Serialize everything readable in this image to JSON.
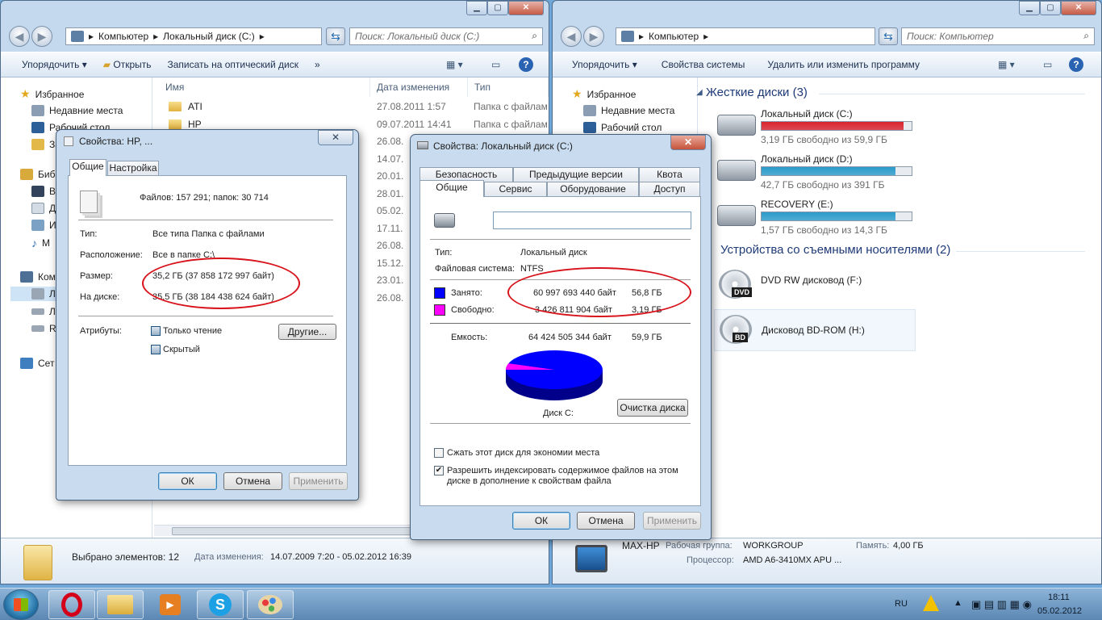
{
  "left_window": {
    "address": [
      "Компьютер",
      "Локальный диск (C:)"
    ],
    "search_placeholder": "Поиск: Локальный диск (C:)",
    "toolbar": {
      "organize": "Упорядочить",
      "open": "Открыть",
      "burn": "Записать на оптический диск",
      "more": "»"
    },
    "nav": {
      "favorites": "Избранное",
      "recent": "Недавние места",
      "desktop": "Рабочий стол",
      "downloads": "За",
      "libraries": "Биб",
      "lib_video": "Ви",
      "lib_docs": "До",
      "lib_images": "Из",
      "lib_music": "М",
      "computer": "Ком",
      "drive_c": "Ло",
      "drive_d": "Ло",
      "recovery": "RE",
      "network": "Сет"
    },
    "columns": {
      "name": "Имя",
      "date": "Дата изменения",
      "type": "Тип"
    },
    "rows": [
      {
        "name": "ATI",
        "date": "27.08.2011 1:57",
        "type": "Папка с файлам"
      },
      {
        "name": "HP",
        "date": "09.07.2011 14:41",
        "type": "Папка с файлам"
      },
      {
        "date": "26.08."
      },
      {
        "date": "14.07."
      },
      {
        "date": "20.01."
      },
      {
        "date": "28.01."
      },
      {
        "date": "05.02."
      },
      {
        "date": "17.11."
      },
      {
        "date": "26.08."
      },
      {
        "date": "15.12."
      },
      {
        "date": "23.01."
      },
      {
        "date": "26.08."
      }
    ],
    "status": {
      "selected": "Выбрано элементов: 12",
      "modified_label": "Дата изменения:",
      "modified_value": "14.07.2009 7:20 - 05.02.2012 16:39"
    }
  },
  "right_window": {
    "address": [
      "Компьютер"
    ],
    "search_placeholder": "Поиск: Компьютер",
    "toolbar": {
      "organize": "Упорядочить",
      "sysprops": "Свойства системы",
      "uninstall": "Удалить или изменить программу"
    },
    "nav": {
      "favorites": "Избранное",
      "recent": "Недавние места",
      "desktop": "Рабочий стол"
    },
    "hdd_group": "Жесткие диски (3)",
    "drives": [
      {
        "name": "Локальный диск (C:)",
        "free": "3,19 ГБ свободно из 59,9 ГБ",
        "used_fraction": 0.947,
        "color": "#d9232d"
      },
      {
        "name": "Локальный диск (D:)",
        "free": "42,7 ГБ свободно из 391 ГБ",
        "used_fraction": 0.891,
        "color": "#2a9bc9"
      },
      {
        "name": "RECOVERY (E:)",
        "free": "1,57 ГБ свободно из 14,3 ГБ",
        "used_fraction": 0.89,
        "color": "#2a9bc9"
      }
    ],
    "removable_group": "Устройства со съемными носителями (2)",
    "removable": [
      {
        "name": "DVD RW дисковод (F:)",
        "badge": "DVD"
      },
      {
        "name": "Дисковод BD-ROM (H:)",
        "badge": "BD"
      }
    ],
    "status": {
      "pc_name": "MAX-HP",
      "workgroup_label": "Рабочая группа:",
      "workgroup": "WORKGROUP",
      "memory_label": "Память:",
      "memory": "4,00 ГБ",
      "cpu_label": "Процессор:",
      "cpu": "AMD A6-3410MX APU ..."
    }
  },
  "hp_dialog": {
    "title": "Свойства: HP, ...",
    "close": "✕",
    "tabs": [
      "Общие",
      "Настройка"
    ],
    "files_line": "Файлов: 157 291; папок: 30 714",
    "rows": [
      {
        "label": "Тип:",
        "value": "Все типа Папка с файлами"
      },
      {
        "label": "Расположение:",
        "value": "Все в папке C:\\"
      },
      {
        "label": "Размер:",
        "value": "35,2 ГБ (37 858 172 997 байт)"
      },
      {
        "label": "На диске:",
        "value": "35,5 ГБ (38 184 438 624 байт)"
      }
    ],
    "attributes_label": "Атрибуты:",
    "readonly": "Только чтение",
    "hidden": "Скрытый",
    "other": "Другие...",
    "ok": "ОК",
    "cancel": "Отмена",
    "apply": "Применить"
  },
  "disk_dialog": {
    "title": "Свойства: Локальный диск (C:)",
    "close": "✕",
    "tabs_top": [
      "Безопасность",
      "Предыдущие версии",
      "Квота"
    ],
    "tabs_bottom": [
      "Общие",
      "Сервис",
      "Оборудование",
      "Доступ"
    ],
    "type_label": "Тип:",
    "type_value": "Локальный диск",
    "fs_label": "Файловая система:",
    "fs_value": "NTFS",
    "used_label": "Занято:",
    "used_bytes": "60 997 693 440 байт",
    "used_gb": "56,8 ГБ",
    "free_label": "Свободно:",
    "free_bytes": "3 426 811 904 байт",
    "free_gb": "3,19 ГБ",
    "capacity_label": "Емкость:",
    "capacity_bytes": "64 424 505 344 байт",
    "capacity_gb": "59,9 ГБ",
    "used_color": "#0000ff",
    "free_color": "#ff00ff",
    "used_fraction": 0.947,
    "disk_label": "Диск C:",
    "cleanup": "Очистка диска",
    "compress": "Сжать этот диск для экономии места",
    "index": "Разрешить индексировать содержимое файлов на этом диске в дополнение к свойствам файла",
    "ok": "ОК",
    "cancel": "Отмена",
    "apply": "Применить"
  },
  "taskbar": {
    "lang": "RU",
    "time": "18:11",
    "date": "05.02.2012"
  }
}
